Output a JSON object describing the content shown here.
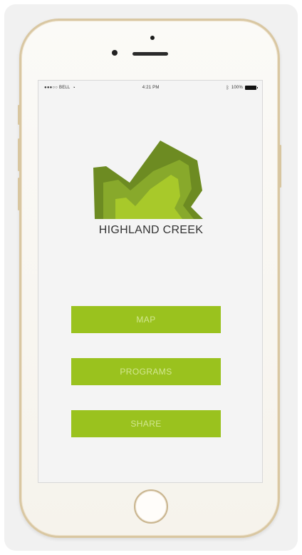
{
  "status_bar": {
    "carrier": "●●●○○ BELL",
    "time": "4:21 PM",
    "battery": "100%"
  },
  "app": {
    "name": "HIGHLAND CREEK",
    "buttons": [
      {
        "label": "MAP"
      },
      {
        "label": "PROGRAMS"
      },
      {
        "label": "SHARE"
      }
    ]
  },
  "colors": {
    "button": "#9ac21e",
    "button_text": "#d9ec9d",
    "logo_dark": "#6d8b22",
    "logo_mid": "#88a92b",
    "logo_light": "#a8c92a",
    "phone_frame": "#d9c7a2"
  },
  "icons": {
    "wifi": "wifi-icon",
    "bluetooth": "bluetooth-icon",
    "battery": "battery-icon"
  }
}
